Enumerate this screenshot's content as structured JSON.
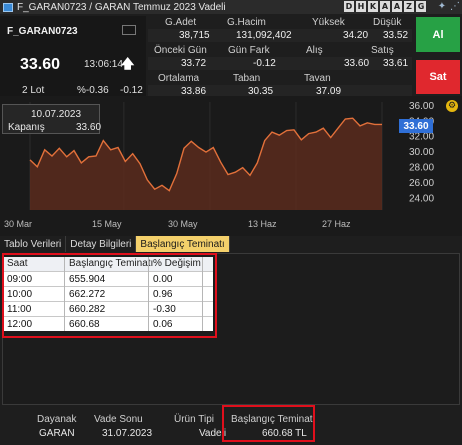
{
  "window": {
    "title": "F_GARAN0723 / GARAN Temmuz 2023 Vadeli",
    "buttons": [
      "D",
      "H",
      "K",
      "A",
      "A",
      "Z",
      "G"
    ],
    "icons": [
      "pin-icon",
      "link-icon"
    ]
  },
  "symbol": {
    "name": "F_GARAN0723",
    "price": "33.60",
    "time": "13:06:14",
    "lot": "2 Lot",
    "pct_change": "%-0.36",
    "change": "-0.12"
  },
  "stats": {
    "g_adet_label": "G.Adet",
    "g_adet": "38,715",
    "g_hacim_label": "G.Hacim",
    "g_hacim": "131,092,402",
    "yuksek_label": "Yüksek",
    "yuksek": "34.20",
    "dusuk_label": "Düşük",
    "dusuk": "33.52",
    "onceki_gun_label": "Önceki Gün",
    "onceki_gun": "33.72",
    "gun_fark_label": "Gün Fark",
    "gun_fark": "-0.12",
    "alis_label": "Alış",
    "alis": "33.60",
    "satis_label": "Satış",
    "satis": "33.61",
    "ortalama_label": "Ortalama",
    "ortalama": "33.86",
    "taban_label": "Taban",
    "taban": "30.35",
    "tavan_label": "Tavan",
    "tavan": "37.09"
  },
  "actions": {
    "buy": "Al",
    "sell": "Sat"
  },
  "chart_data": {
    "type": "area",
    "x_tick_labels": [
      "30 Mar",
      "15 May",
      "30 May",
      "13 Haz",
      "27 Haz"
    ],
    "y_tick_labels": [
      "24.00",
      "26.00",
      "28.00",
      "30.00",
      "32.00",
      "34.00",
      "36.00"
    ],
    "ylim": [
      22.5,
      36.5
    ],
    "values": [
      29.0,
      28.1,
      30.3,
      29.5,
      30.5,
      29.4,
      30.2,
      28.6,
      29.4,
      29.5,
      31.5,
      30.3,
      30.6,
      28.8,
      29.8,
      28.5,
      26.4,
      25.2,
      25.7,
      25.0,
      27.2,
      30.5,
      31.4,
      30.6,
      30.0,
      30.6,
      28.7,
      27.1,
      27.4,
      28.0,
      27.0,
      28.6,
      31.5,
      32.6,
      32.2,
      32.8,
      32.9,
      31.6,
      32.4,
      32.6,
      33.1,
      31.9,
      33.1,
      34.3,
      34.4,
      33.4,
      33.8,
      33.6,
      33.6
    ],
    "current_label": "33.60",
    "line_color": "#e2703a",
    "fill_color": "#5a2b1d",
    "tooltip": {
      "date": "10.07.2023",
      "label": "Kapanış",
      "value": "33.60"
    }
  },
  "tabs": [
    {
      "label": "Tablo Verileri",
      "active": false
    },
    {
      "label": "Detay Bilgileri",
      "active": false
    },
    {
      "label": "Başlangıç Teminatı",
      "active": true
    }
  ],
  "table": {
    "headers": [
      "Saat",
      "Başlangıç Teminatı",
      "% Değişim"
    ],
    "rows": [
      [
        "09:00",
        "655.904",
        "0.00"
      ],
      [
        "10:00",
        "662.272",
        "0.96"
      ],
      [
        "11:00",
        "660.282",
        "-0.30"
      ],
      [
        "12:00",
        "660.68",
        "0.06"
      ]
    ]
  },
  "footer": {
    "dayanak_label": "Dayanak",
    "dayanak": "GARAN",
    "vade_sonu_label": "Vade Sonu",
    "vade_sonu": "31.07.2023",
    "urun_tipi_label": "Ürün Tipi",
    "urun_tipi": "Vadeli",
    "teminat_label": "Başlangıç Teminatı",
    "teminat": "660.68 TL"
  },
  "colors": {
    "highlight": "#e00f1c",
    "buy": "#27a145",
    "sell": "#e0282e",
    "price_tag": "#2f6fd6",
    "active_tab": "#f4d06b"
  }
}
